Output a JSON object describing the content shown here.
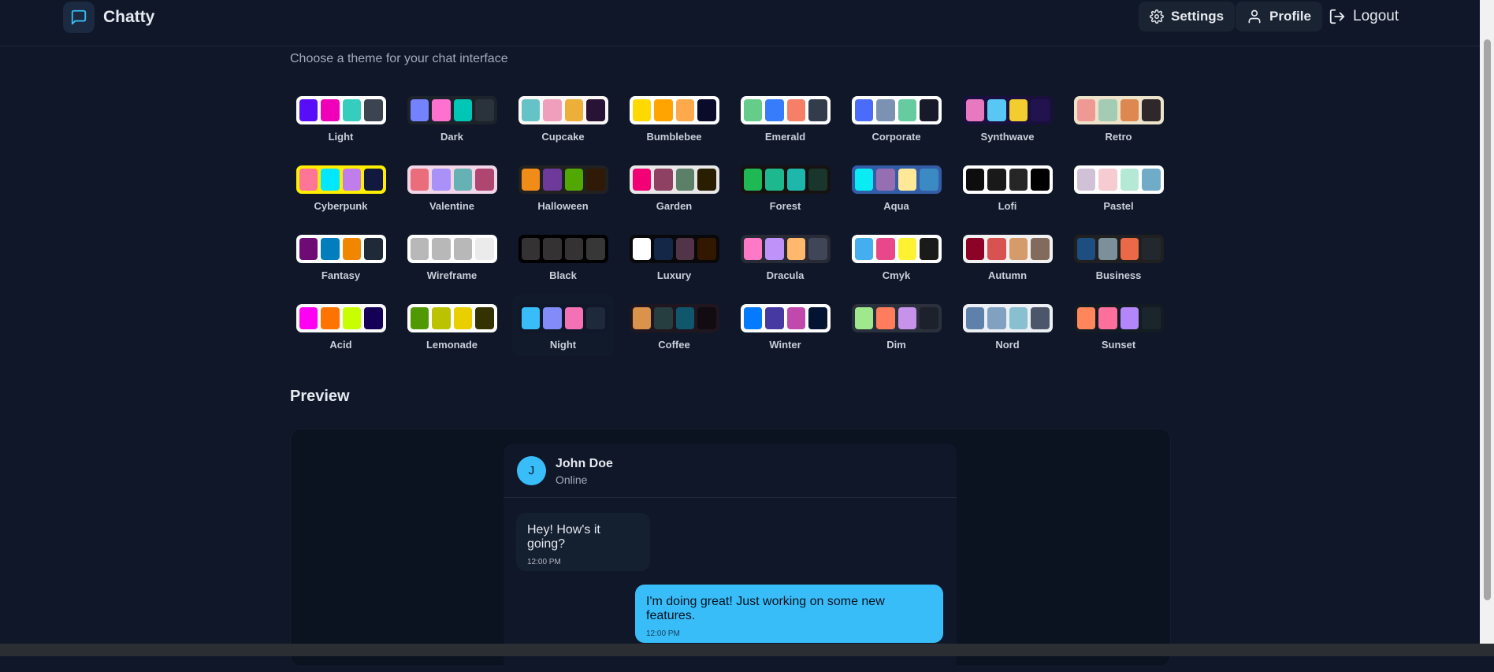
{
  "app": {
    "name": "Chatty"
  },
  "nav": {
    "settings_label": "Settings",
    "profile_label": "Profile",
    "logout_label": "Logout"
  },
  "page": {
    "subtitle": "Choose a theme for your chat interface"
  },
  "themes": [
    {
      "name": "Light",
      "frame": "#ffffff",
      "colors": [
        "#570df8",
        "#f000b8",
        "#37cdbe",
        "#3d4451"
      ]
    },
    {
      "name": "Dark",
      "frame": "#1d232a",
      "colors": [
        "#7582ff",
        "#ff71cf",
        "#00c7b5",
        "#2a323c"
      ]
    },
    {
      "name": "Cupcake",
      "frame": "#faf7f5",
      "colors": [
        "#65c3c8",
        "#ef9fbc",
        "#eeaf3a",
        "#291334"
      ]
    },
    {
      "name": "Bumblebee",
      "frame": "#ffffff",
      "colors": [
        "#ffd900",
        "#ffa400",
        "#ffa94d",
        "#0a0a2a"
      ]
    },
    {
      "name": "Emerald",
      "frame": "#ffffff",
      "colors": [
        "#66cc8a",
        "#377cfb",
        "#f68067",
        "#333c4d"
      ]
    },
    {
      "name": "Corporate",
      "frame": "#ffffff",
      "colors": [
        "#4b6bfb",
        "#7b92b2",
        "#67cba0",
        "#181a2a"
      ]
    },
    {
      "name": "Synthwave",
      "frame": "#1a103d",
      "colors": [
        "#e779c1",
        "#58c7f3",
        "#f3cc30",
        "#20134e"
      ]
    },
    {
      "name": "Retro",
      "frame": "#ece3ca",
      "colors": [
        "#ef9995",
        "#a4cbb4",
        "#dc8850",
        "#2e282a"
      ]
    },
    {
      "name": "Cyberpunk",
      "frame": "#ffee00",
      "colors": [
        "#ff7598",
        "#00e7ff",
        "#c07eec",
        "#111a3e"
      ]
    },
    {
      "name": "Valentine",
      "frame": "#f0d6e8",
      "colors": [
        "#e96d7b",
        "#a991f7",
        "#66b1b3",
        "#af4670"
      ]
    },
    {
      "name": "Halloween",
      "frame": "#212121",
      "colors": [
        "#f28c18",
        "#6d3a9c",
        "#51a800",
        "#2f1b05"
      ]
    },
    {
      "name": "Garden",
      "frame": "#e9e7e7",
      "colors": [
        "#f40076",
        "#8e4162",
        "#5c7f67",
        "#291e00"
      ]
    },
    {
      "name": "Forest",
      "frame": "#171212",
      "colors": [
        "#1eb854",
        "#1db88e",
        "#1db8ab",
        "#19362d"
      ]
    },
    {
      "name": "Aqua",
      "frame": "#345da7",
      "colors": [
        "#09ecf3",
        "#966fb3",
        "#ffe999",
        "#3b8ac4"
      ]
    },
    {
      "name": "Lofi",
      "frame": "#ffffff",
      "colors": [
        "#0d0d0d",
        "#1a1919",
        "#262626",
        "#000000"
      ]
    },
    {
      "name": "Pastel",
      "frame": "#ffffff",
      "colors": [
        "#d1c1d7",
        "#f6cbd1",
        "#b4e9d6",
        "#70acc7"
      ]
    },
    {
      "name": "Fantasy",
      "frame": "#ffffff",
      "colors": [
        "#6e0b75",
        "#007ebd",
        "#f18700",
        "#1f2937"
      ]
    },
    {
      "name": "Wireframe",
      "frame": "#ffffff",
      "colors": [
        "#b8b8b8",
        "#b8b8b8",
        "#b8b8b8",
        "#ebebeb"
      ]
    },
    {
      "name": "Black",
      "frame": "#000000",
      "colors": [
        "#343232",
        "#343232",
        "#343232",
        "#373737"
      ]
    },
    {
      "name": "Luxury",
      "frame": "#09090b",
      "colors": [
        "#ffffff",
        "#152747",
        "#513448",
        "#331800"
      ]
    },
    {
      "name": "Dracula",
      "frame": "#282a36",
      "colors": [
        "#ff79c6",
        "#bd93f9",
        "#ffb86c",
        "#414558"
      ]
    },
    {
      "name": "Cmyk",
      "frame": "#ffffff",
      "colors": [
        "#45aeee",
        "#e8488a",
        "#fff232",
        "#1a1a1a"
      ]
    },
    {
      "name": "Autumn",
      "frame": "#f1f1f1",
      "colors": [
        "#8c0327",
        "#d85251",
        "#d59b6a",
        "#826a5c"
      ]
    },
    {
      "name": "Business",
      "frame": "#202020",
      "colors": [
        "#1c4e80",
        "#7c909a",
        "#ea6947",
        "#23282e"
      ]
    },
    {
      "name": "Acid",
      "frame": "#fafafa",
      "colors": [
        "#ff00f4",
        "#ff7400",
        "#c8ff00",
        "#140055"
      ]
    },
    {
      "name": "Lemonade",
      "frame": "#ffffff",
      "colors": [
        "#519903",
        "#bbc200",
        "#eacf00",
        "#343300"
      ]
    },
    {
      "name": "Night",
      "frame": "#0f1729",
      "colors": [
        "#38bdf8",
        "#818cf8",
        "#f471b5",
        "#1e293b"
      ]
    },
    {
      "name": "Coffee",
      "frame": "#20161f",
      "colors": [
        "#db924b",
        "#263e3f",
        "#10576d",
        "#120c12"
      ]
    },
    {
      "name": "Winter",
      "frame": "#ffffff",
      "colors": [
        "#047aff",
        "#463aa2",
        "#c148ac",
        "#021431"
      ]
    },
    {
      "name": "Dim",
      "frame": "#2a303c",
      "colors": [
        "#9fe88d",
        "#ff7d5c",
        "#c792e9",
        "#1c212b"
      ]
    },
    {
      "name": "Nord",
      "frame": "#eceff4",
      "colors": [
        "#5e81ac",
        "#81a1c1",
        "#88c0d0",
        "#4c566a"
      ]
    },
    {
      "name": "Sunset",
      "frame": "#121c22",
      "colors": [
        "#ff865b",
        "#fd6f9c",
        "#b387fa",
        "#1b262c"
      ]
    }
  ],
  "active_theme": "Night",
  "preview": {
    "title": "Preview",
    "contact": {
      "initial": "J",
      "name": "John Doe",
      "status": "Online"
    },
    "messages": [
      {
        "text": "Hey! How's it going?",
        "time": "12:00 PM"
      },
      {
        "text": "I'm doing great! Just working on some new features.",
        "time": "12:00 PM"
      }
    ]
  }
}
